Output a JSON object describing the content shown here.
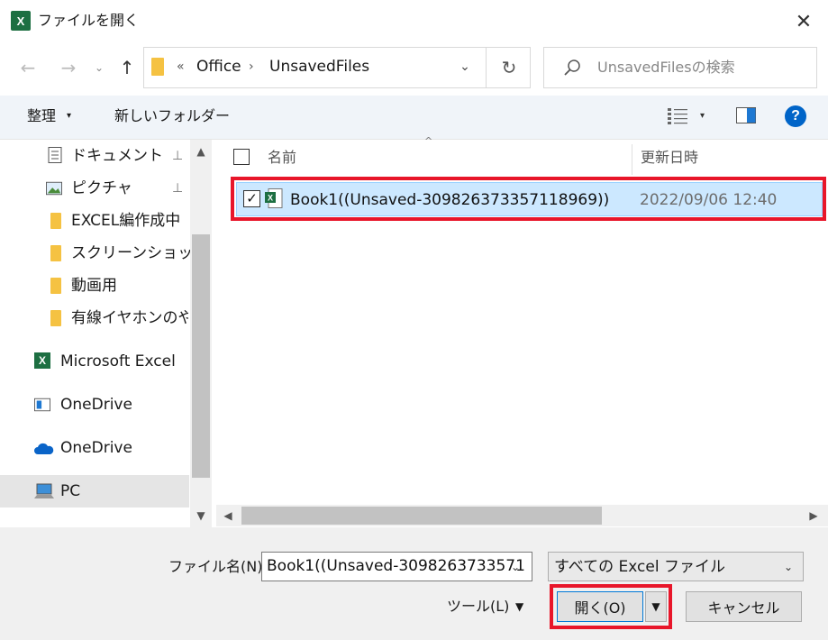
{
  "window": {
    "title": "ファイルを開く",
    "app_icon_letter": "X",
    "close_glyph": "✕"
  },
  "nav": {
    "back_glyph": "←",
    "forward_glyph": "→",
    "recent_glyph": "⌄",
    "up_glyph": "↑",
    "address": {
      "more_glyph": "«",
      "crumbs": [
        "Office",
        "UnsavedFiles"
      ],
      "sep_glyph": "›",
      "dropdown_glyph": "⌄",
      "refresh_glyph": "↻"
    },
    "search": {
      "placeholder": "UnsavedFilesの検索"
    }
  },
  "toolbar": {
    "organize_label": "整理",
    "organize_caret": "▾",
    "new_folder_label": "新しいフォルダー",
    "view_caret": "▾",
    "help_glyph": "?"
  },
  "sidebar": {
    "items": [
      {
        "label": "ドキュメント",
        "icon": "document-icon",
        "pinned": true
      },
      {
        "label": "ピクチャ",
        "icon": "pictures-icon",
        "pinned": true
      },
      {
        "label": "EXCEL編作成中",
        "icon": "folder-icon"
      },
      {
        "label": "スクリーンショット",
        "icon": "folder-icon"
      },
      {
        "label": "動画用",
        "icon": "folder-icon"
      },
      {
        "label": "有線イヤホンのやつ",
        "icon": "folder-icon"
      },
      {
        "label": "Microsoft Excel",
        "icon": "excel-icon"
      },
      {
        "label": "OneDrive",
        "icon": "onedrive-icon"
      },
      {
        "label": "OneDrive",
        "icon": "cloud-icon"
      },
      {
        "label": "PC",
        "icon": "pc-icon",
        "selected": true
      }
    ],
    "pin_glyph": "📌",
    "scroll_up_glyph": "▲",
    "scroll_down_glyph": "▼"
  },
  "filelist": {
    "columns": {
      "name": "名前",
      "date": "更新日時"
    },
    "sort_glyph": "^",
    "rows": [
      {
        "name": "Book1((Unsaved-309826373357118969))",
        "date": "2022/09/06 12:40",
        "checked": true
      }
    ],
    "check_glyph": "✓",
    "hscroll_left_glyph": "◀",
    "hscroll_right_glyph": "▶"
  },
  "bottom": {
    "filename_label": "ファイル名(N):",
    "filename_value": "Book1((Unsaved-3098263733571",
    "dropdown_glyph": "⌄",
    "filetype_value": "すべての Excel ファイル",
    "tools_label": "ツール(L)",
    "tools_caret": "▼",
    "open_label": "開く(O)",
    "open_split_glyph": "▼",
    "cancel_label": "キャンセル"
  },
  "colors": {
    "accent": "#0078d7",
    "highlight": "#e8162a",
    "selection": "#cce8ff",
    "excel": "#1d6f42",
    "folder": "#f5c242"
  }
}
